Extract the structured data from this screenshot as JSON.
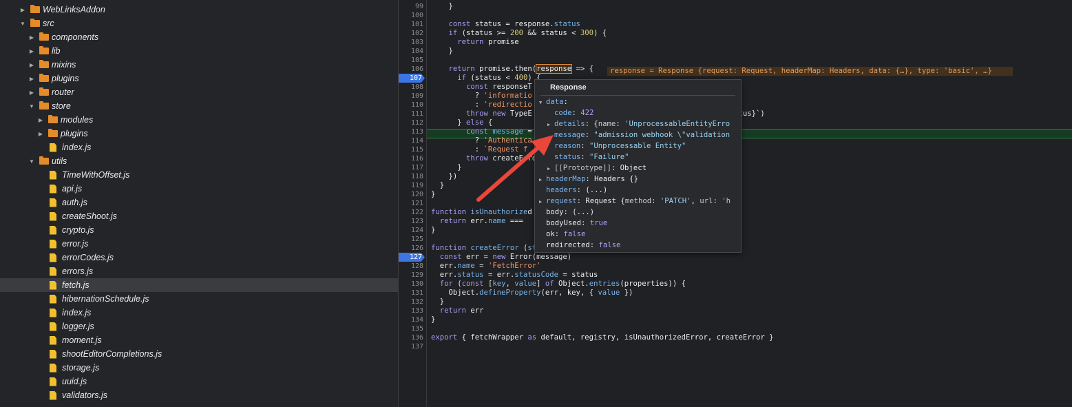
{
  "tree": [
    {
      "label": "WebLinksAddon",
      "type": "folder",
      "depth": 1,
      "expanded": false,
      "selected": false
    },
    {
      "label": "src",
      "type": "folder",
      "depth": 1,
      "expanded": true,
      "selected": false
    },
    {
      "label": "components",
      "type": "folder",
      "depth": 2,
      "expanded": false,
      "selected": false
    },
    {
      "label": "lib",
      "type": "folder",
      "depth": 2,
      "expanded": false,
      "selected": false
    },
    {
      "label": "mixins",
      "type": "folder",
      "depth": 2,
      "expanded": false,
      "selected": false
    },
    {
      "label": "plugins",
      "type": "folder",
      "depth": 2,
      "expanded": false,
      "selected": false
    },
    {
      "label": "router",
      "type": "folder",
      "depth": 2,
      "expanded": false,
      "selected": false
    },
    {
      "label": "store",
      "type": "folder",
      "depth": 2,
      "expanded": true,
      "selected": false
    },
    {
      "label": "modules",
      "type": "folder",
      "depth": 3,
      "expanded": false,
      "selected": false
    },
    {
      "label": "plugins",
      "type": "folder",
      "depth": 3,
      "expanded": false,
      "selected": false
    },
    {
      "label": "index.js",
      "type": "file",
      "depth": 3,
      "selected": false
    },
    {
      "label": "utils",
      "type": "folder",
      "depth": 2,
      "expanded": true,
      "selected": false
    },
    {
      "label": "TimeWithOffset.js",
      "type": "file",
      "depth": 3,
      "selected": false
    },
    {
      "label": "api.js",
      "type": "file",
      "depth": 3,
      "selected": false
    },
    {
      "label": "auth.js",
      "type": "file",
      "depth": 3,
      "selected": false
    },
    {
      "label": "createShoot.js",
      "type": "file",
      "depth": 3,
      "selected": false
    },
    {
      "label": "crypto.js",
      "type": "file",
      "depth": 3,
      "selected": false
    },
    {
      "label": "error.js",
      "type": "file",
      "depth": 3,
      "selected": false
    },
    {
      "label": "errorCodes.js",
      "type": "file",
      "depth": 3,
      "selected": false
    },
    {
      "label": "errors.js",
      "type": "file",
      "depth": 3,
      "selected": false
    },
    {
      "label": "fetch.js",
      "type": "file",
      "depth": 3,
      "selected": true
    },
    {
      "label": "hibernationSchedule.js",
      "type": "file",
      "depth": 3,
      "selected": false
    },
    {
      "label": "index.js",
      "type": "file",
      "depth": 3,
      "selected": false
    },
    {
      "label": "logger.js",
      "type": "file",
      "depth": 3,
      "selected": false
    },
    {
      "label": "moment.js",
      "type": "file",
      "depth": 3,
      "selected": false
    },
    {
      "label": "shootEditorCompletions.js",
      "type": "file",
      "depth": 3,
      "selected": false
    },
    {
      "label": "storage.js",
      "type": "file",
      "depth": 3,
      "selected": false
    },
    {
      "label": "uuid.js",
      "type": "file",
      "depth": 3,
      "selected": false
    },
    {
      "label": "validators.js",
      "type": "file",
      "depth": 3,
      "selected": false
    }
  ],
  "editor": {
    "breakpoint_lines": [
      107,
      127
    ],
    "highlighted_line": 113,
    "hover_word": "response",
    "inline_value": "response = Response {request: Request, headerMap: Headers, data: {…}, type: 'basic', …}",
    "lines": [
      {
        "n": 99,
        "segs": [
          [
            "    }",
            ""
          ]
        ]
      },
      {
        "n": 100,
        "segs": []
      },
      {
        "n": 101,
        "segs": [
          [
            "    ",
            ""
          ],
          [
            "const",
            "kw"
          ],
          [
            " status = response.",
            ""
          ],
          [
            "status",
            "prop"
          ]
        ]
      },
      {
        "n": 102,
        "segs": [
          [
            "    ",
            ""
          ],
          [
            "if",
            "kw"
          ],
          [
            " (status >= ",
            ""
          ],
          [
            "200",
            "num"
          ],
          [
            " && status < ",
            ""
          ],
          [
            "300",
            "num"
          ],
          [
            ") {",
            ""
          ]
        ]
      },
      {
        "n": 103,
        "segs": [
          [
            "      ",
            ""
          ],
          [
            "return",
            "kw"
          ],
          [
            " promise",
            ""
          ]
        ]
      },
      {
        "n": 104,
        "segs": [
          [
            "    }",
            ""
          ]
        ]
      },
      {
        "n": 105,
        "segs": []
      },
      {
        "n": 106,
        "segs": [
          [
            "    ",
            ""
          ],
          [
            "return",
            "kw"
          ],
          [
            " promise.",
            ""
          ],
          [
            "then",
            "fn"
          ],
          [
            "(",
            ""
          ],
          [
            "response",
            "hover"
          ],
          [
            " => {",
            ""
          ]
        ]
      },
      {
        "n": 107,
        "segs": [
          [
            "      ",
            ""
          ],
          [
            "if",
            "kw"
          ],
          [
            " (status < ",
            ""
          ],
          [
            "400",
            "num"
          ],
          [
            ") {",
            ""
          ]
        ]
      },
      {
        "n": 108,
        "segs": [
          [
            "        ",
            ""
          ],
          [
            "const",
            "kw"
          ],
          [
            " responseT",
            ""
          ]
        ]
      },
      {
        "n": 109,
        "segs": [
          [
            "          ? ",
            ""
          ],
          [
            "'informatio",
            "str"
          ]
        ]
      },
      {
        "n": 110,
        "segs": [
          [
            "          : ",
            ""
          ],
          [
            "'redirectio",
            "str"
          ]
        ]
      },
      {
        "n": 111,
        "segs": [
          [
            "        ",
            ""
          ],
          [
            "throw",
            "kw"
          ],
          [
            " ",
            ""
          ],
          [
            "new",
            "kw"
          ],
          [
            " TypeE",
            ""
          ],
          [
            "                            h status code ${status}`)",
            ""
          ]
        ]
      },
      {
        "n": 112,
        "segs": [
          [
            "      } ",
            ""
          ],
          [
            "else",
            "kw"
          ],
          [
            " {",
            ""
          ]
        ]
      },
      {
        "n": 113,
        "segs": [
          [
            "        ",
            ""
          ],
          [
            "const",
            "kw"
          ],
          [
            " ",
            ""
          ],
          [
            "message",
            "prop"
          ],
          [
            " =",
            ""
          ]
        ]
      },
      {
        "n": 114,
        "segs": [
          [
            "          ? ",
            ""
          ],
          [
            "'Authentica",
            "str"
          ]
        ]
      },
      {
        "n": 115,
        "segs": [
          [
            "          : ",
            ""
          ],
          [
            "`Request f",
            "str"
          ]
        ]
      },
      {
        "n": 116,
        "segs": [
          [
            "        ",
            ""
          ],
          [
            "throw",
            "kw"
          ],
          [
            " createErro",
            ""
          ]
        ]
      },
      {
        "n": 117,
        "segs": [
          [
            "      }",
            ""
          ]
        ]
      },
      {
        "n": 118,
        "segs": [
          [
            "    })",
            ""
          ]
        ]
      },
      {
        "n": 119,
        "segs": [
          [
            "  }",
            ""
          ]
        ]
      },
      {
        "n": 120,
        "segs": [
          [
            "}",
            ""
          ]
        ]
      },
      {
        "n": 121,
        "segs": []
      },
      {
        "n": 122,
        "segs": [
          [
            "function",
            "kw"
          ],
          [
            " ",
            ""
          ],
          [
            "isUnauthorize",
            "prop"
          ],
          [
            "d",
            ""
          ]
        ]
      },
      {
        "n": 123,
        "segs": [
          [
            "  ",
            ""
          ],
          [
            "return",
            "kw"
          ],
          [
            " err.",
            ""
          ],
          [
            "name",
            "prop"
          ],
          [
            " === ",
            ""
          ]
        ]
      },
      {
        "n": 124,
        "segs": [
          [
            "}",
            ""
          ]
        ]
      },
      {
        "n": 125,
        "segs": []
      },
      {
        "n": 126,
        "segs": [
          [
            "function",
            "kw"
          ],
          [
            " ",
            ""
          ],
          [
            "createError",
            "prop"
          ],
          [
            " (",
            ""
          ],
          [
            "status, message, properties = {}) {",
            "prop"
          ]
        ]
      },
      {
        "n": 127,
        "segs": [
          [
            "  ",
            ""
          ],
          [
            "const",
            "kw"
          ],
          [
            " err = ",
            ""
          ],
          [
            "new",
            "kw"
          ],
          [
            " Error(message)",
            ""
          ]
        ]
      },
      {
        "n": 128,
        "segs": [
          [
            "  err.",
            ""
          ],
          [
            "name",
            "prop"
          ],
          [
            " = ",
            ""
          ],
          [
            "'FetchError'",
            "str"
          ]
        ]
      },
      {
        "n": 129,
        "segs": [
          [
            "  err.",
            ""
          ],
          [
            "status",
            "prop"
          ],
          [
            " = err.",
            ""
          ],
          [
            "statusCode",
            "prop"
          ],
          [
            " = status",
            ""
          ]
        ]
      },
      {
        "n": 130,
        "segs": [
          [
            "  ",
            ""
          ],
          [
            "for",
            "kw"
          ],
          [
            " (",
            ""
          ],
          [
            "const",
            "kw"
          ],
          [
            " [",
            ""
          ],
          [
            "key",
            "prop"
          ],
          [
            ", ",
            ""
          ],
          [
            "value",
            "prop"
          ],
          [
            "] ",
            ""
          ],
          [
            "of",
            "kw"
          ],
          [
            " Object.",
            ""
          ],
          [
            "entries",
            "prop"
          ],
          [
            "(properties)) {",
            ""
          ]
        ]
      },
      {
        "n": 131,
        "segs": [
          [
            "    Object.",
            ""
          ],
          [
            "defineProperty",
            "prop"
          ],
          [
            "(err, key, { ",
            ""
          ],
          [
            "value",
            "prop"
          ],
          [
            " })",
            ""
          ]
        ]
      },
      {
        "n": 132,
        "segs": [
          [
            "  }",
            ""
          ]
        ]
      },
      {
        "n": 133,
        "segs": [
          [
            "  ",
            ""
          ],
          [
            "return",
            "kw"
          ],
          [
            " err",
            ""
          ]
        ]
      },
      {
        "n": 134,
        "segs": [
          [
            "}",
            ""
          ]
        ]
      },
      {
        "n": 135,
        "segs": []
      },
      {
        "n": 136,
        "segs": [
          [
            "export",
            "kw"
          ],
          [
            " { fetchWrapper ",
            ""
          ],
          [
            "as",
            "kw"
          ],
          [
            " ",
            ""
          ],
          [
            "default",
            "fn"
          ],
          [
            ", registry, isUnauthorizedError, createError }",
            ""
          ]
        ]
      },
      {
        "n": 137,
        "segs": []
      }
    ]
  },
  "popover": {
    "title": "Response",
    "rows": [
      {
        "indent": 0,
        "tri": "down",
        "parts": [
          [
            "data",
            "pk"
          ],
          [
            ":",
            ""
          ]
        ]
      },
      {
        "indent": 1,
        "tri": "",
        "parts": [
          [
            "code",
            "pk"
          ],
          [
            ": ",
            ""
          ],
          [
            "422",
            "pn"
          ]
        ]
      },
      {
        "indent": 1,
        "tri": "right",
        "parts": [
          [
            "details",
            "pk"
          ],
          [
            ": {",
            ""
          ],
          [
            "name",
            "pg"
          ],
          [
            ": ",
            ""
          ],
          [
            "'UnprocessableEntityErro",
            "ps"
          ]
        ]
      },
      {
        "indent": 1,
        "tri": "",
        "parts": [
          [
            "message",
            "pk"
          ],
          [
            ": ",
            ""
          ],
          [
            "\"admission webhook \\\"validation",
            "ps"
          ]
        ]
      },
      {
        "indent": 1,
        "tri": "",
        "parts": [
          [
            "reason",
            "pk"
          ],
          [
            ": ",
            ""
          ],
          [
            "\"Unprocessable Entity\"",
            "ps"
          ]
        ]
      },
      {
        "indent": 1,
        "tri": "",
        "parts": [
          [
            "status",
            "pk"
          ],
          [
            ": ",
            ""
          ],
          [
            "\"Failure\"",
            "ps"
          ]
        ]
      },
      {
        "indent": 1,
        "tri": "right",
        "parts": [
          [
            "[[Prototype]]",
            "pg"
          ],
          [
            ": Object",
            ""
          ]
        ]
      },
      {
        "indent": 0,
        "tri": "right",
        "parts": [
          [
            "headerMap",
            "pk"
          ],
          [
            ": Headers {}",
            ""
          ]
        ]
      },
      {
        "indent": 0,
        "tri": "",
        "parts": [
          [
            "headers",
            "pk"
          ],
          [
            ": (...)",
            ""
          ]
        ]
      },
      {
        "indent": 0,
        "tri": "right",
        "parts": [
          [
            "request",
            "pk"
          ],
          [
            ": Request {",
            ""
          ],
          [
            "method",
            "pg"
          ],
          [
            ": ",
            ""
          ],
          [
            "'PATCH'",
            "ps"
          ],
          [
            ", ",
            ""
          ],
          [
            "url",
            "pg"
          ],
          [
            ": ",
            ""
          ],
          [
            "'h",
            "ps"
          ]
        ]
      },
      {
        "indent": 0,
        "tri": "",
        "parts": [
          [
            "body: (...)",
            ""
          ]
        ]
      },
      {
        "indent": 0,
        "tri": "",
        "parts": [
          [
            "bodyUsed: ",
            ""
          ],
          [
            "true",
            "pb"
          ]
        ]
      },
      {
        "indent": 0,
        "tri": "",
        "parts": [
          [
            "ok: ",
            ""
          ],
          [
            "false",
            "pb"
          ]
        ]
      },
      {
        "indent": 0,
        "tri": "",
        "parts": [
          [
            "redirected: ",
            ""
          ],
          [
            "false",
            "pb"
          ]
        ]
      }
    ]
  },
  "colors": {
    "accent": "#3d76e2",
    "folder": "#e48c2a",
    "file": "#f2c02e",
    "arrow": "#e8473a"
  }
}
